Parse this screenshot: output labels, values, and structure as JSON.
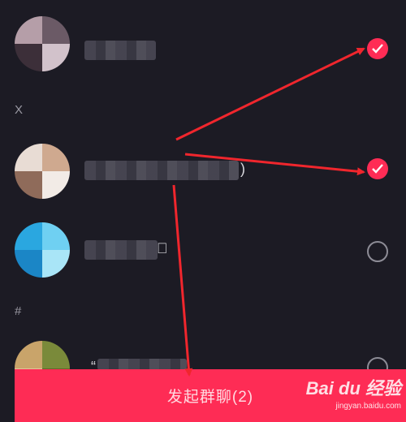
{
  "contacts": [
    {
      "avatar_colors": [
        "#b59ea8",
        "#6b5a66",
        "#3c2f39",
        "#d2c2cb"
      ],
      "selected": true
    },
    {
      "avatar_colors": [
        "#e8dcd4",
        "#cfa98f",
        "#8f6b5a",
        "#f2ebe6"
      ],
      "name_tail": ")",
      "selected": true
    },
    {
      "avatar_colors": [
        "#2aa7e0",
        "#6fd0f2",
        "#1b86c6",
        "#a9e5f7"
      ],
      "name_tail": "𡉺",
      "selected": false
    },
    {
      "avatar_colors": [
        "#c9a46a",
        "#7a8a3a",
        "#e0c79a",
        "#5d6b2a"
      ],
      "name_tail": "“",
      "selected": false
    }
  ],
  "sections": {
    "x_label": "X",
    "hash_label": "#"
  },
  "action": {
    "start_group_label": "发起群聊(2)"
  },
  "watermark": {
    "logo": "Bai du 经验",
    "url": "jingyan.baidu.com"
  },
  "colors": {
    "accent": "#fe2c55",
    "background": "#1c1b24",
    "arrow": "#f0262d"
  },
  "icons": {
    "check": "check-icon",
    "radio": "radio-empty-icon"
  }
}
